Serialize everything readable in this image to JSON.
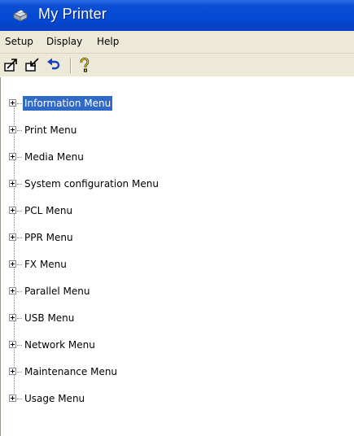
{
  "window": {
    "title": "My Printer"
  },
  "menubar": {
    "items": [
      "Setup",
      "Display",
      "Help"
    ]
  },
  "toolbar": {
    "buttons": [
      "upload-icon",
      "download-icon",
      "undo-icon",
      "help-key-icon"
    ]
  },
  "tree": {
    "selected_index": 0,
    "items": [
      "Information Menu",
      "Print Menu",
      "Media Menu",
      "System configuration Menu",
      "PCL Menu",
      "PPR Menu",
      "FX Menu",
      "Parallel Menu",
      "USB Menu",
      "Network Menu",
      "Maintenance Menu",
      "Usage Menu"
    ]
  }
}
